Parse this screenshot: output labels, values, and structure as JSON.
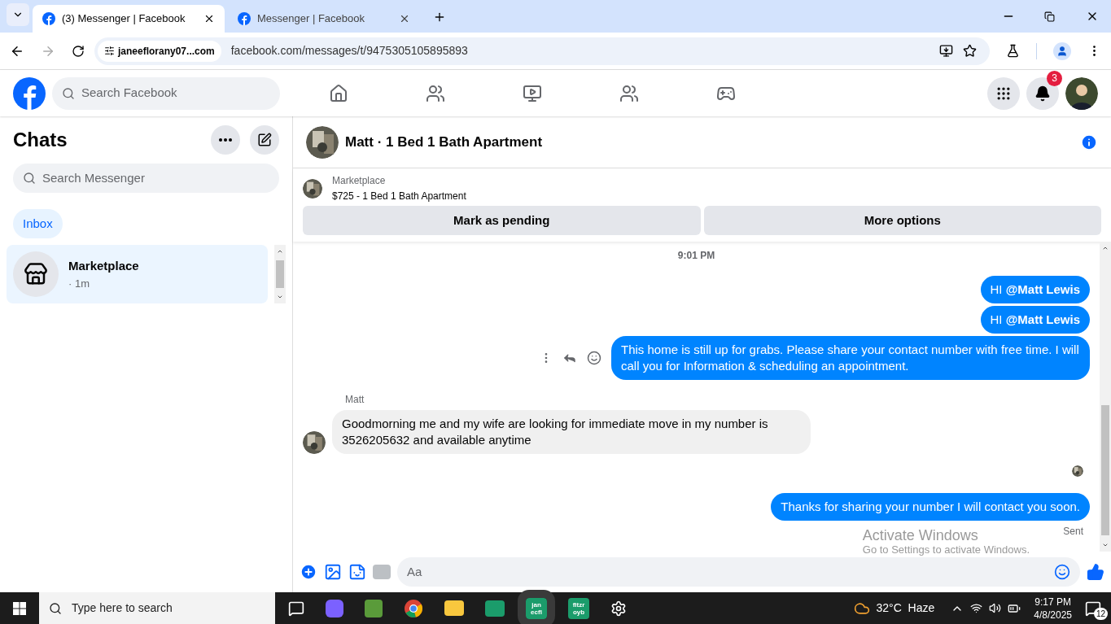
{
  "browser": {
    "tabs": [
      {
        "title": "(3) Messenger | Facebook",
        "selected": true
      },
      {
        "title": "Messenger | Facebook",
        "selected": false
      }
    ],
    "site_chip": "janeeflorany07...com",
    "url": "facebook.com/messages/t/9475305105895893"
  },
  "header": {
    "search_placeholder": "Search Facebook",
    "notification_count": "3"
  },
  "sidebar": {
    "title": "Chats",
    "search_placeholder": "Search Messenger",
    "filter": {
      "label": "Inbox",
      "selected": true
    },
    "chats": [
      {
        "name": "Marketplace",
        "time": "· 1m",
        "selected": true
      }
    ]
  },
  "conversation": {
    "title": "Matt · 1 Bed 1 Bath Apartment",
    "listing": {
      "source": "Marketplace",
      "title": "$725 - 1 Bed 1 Bath Apartment"
    },
    "actions": [
      "Mark as pending",
      "More options"
    ],
    "timestamp": "9:01 PM",
    "messages": [
      {
        "kind": "outgoing",
        "text": "HI **@Matt Lewis**",
        "actions": false
      },
      {
        "kind": "outgoing",
        "text": "HI **@Matt Lewis**",
        "actions": false
      },
      {
        "kind": "outgoing",
        "text": "This home is still up for grabs. Please share your contact number with free time. I will call you for Information & scheduling an appointment.",
        "actions": true
      },
      {
        "kind": "incoming",
        "sender": "Matt",
        "text": "Goodmorning me and my wife are looking for immediate move in my number is 3526205632 and available anytime"
      },
      {
        "kind": "seen"
      },
      {
        "kind": "outgoing",
        "text": "Thanks for sharing your number I will contact you soon.",
        "actions": false,
        "status": "Sent"
      }
    ],
    "composer_placeholder": "Aa"
  },
  "activation": {
    "title": "Activate Windows",
    "subtitle": "Go to Settings to activate Windows."
  },
  "taskbar": {
    "search_placeholder": "Type here to search",
    "apps": [
      {
        "kind": "plain"
      },
      {
        "kind": "text",
        "label": "jan ecfl"
      },
      {
        "kind": "text",
        "label": "fitzr oyb"
      }
    ],
    "weather": "32°C  Haze",
    "time": "9:17 PM",
    "date": "4/8/2025",
    "notifications": "12"
  }
}
